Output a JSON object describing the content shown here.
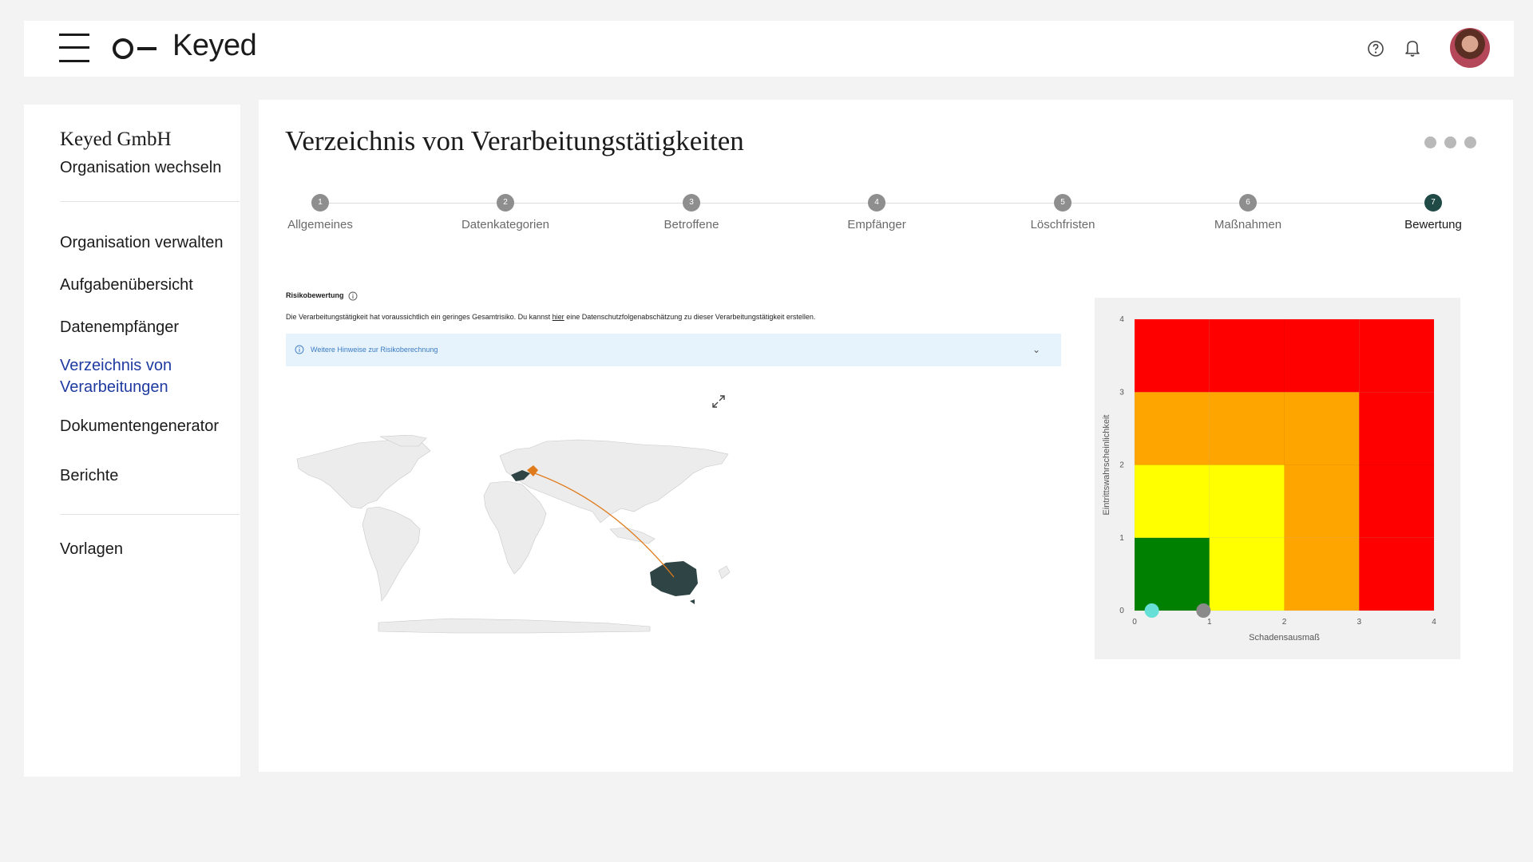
{
  "app": {
    "logo_text": "Keyed"
  },
  "sidebar": {
    "org_name": "Keyed GmbH",
    "switch_label": "Organisation wechseln",
    "items": [
      {
        "label": "Organisation verwalten"
      },
      {
        "label": "Aufgabenübersicht"
      },
      {
        "label": "Datenempfänger"
      },
      {
        "label": "Verzeichnis von Verarbeitungen",
        "active": true
      },
      {
        "label": "Dokumentengenerator"
      },
      {
        "label": "Berichte"
      },
      {
        "label": "Vorlagen"
      }
    ]
  },
  "main": {
    "title": "Verzeichnis von Verarbeitungstätigkeiten",
    "steps": [
      {
        "num": "1",
        "label": "Allgemeines"
      },
      {
        "num": "2",
        "label": "Datenkategorien"
      },
      {
        "num": "3",
        "label": "Betroffene"
      },
      {
        "num": "4",
        "label": "Empfänger"
      },
      {
        "num": "5",
        "label": "Löschfristen"
      },
      {
        "num": "6",
        "label": "Maßnahmen"
      },
      {
        "num": "7",
        "label": "Bewertung",
        "current": true
      }
    ],
    "risk": {
      "heading": "Risikobewertung",
      "text_before": "Die Verarbeitungstätigkeit hat voraussichtlich ein geringes Gesamtrisiko. Du kannst ",
      "link": "hier",
      "text_after": " eine Datenschutzfolgenabschätzung zu dieser Verarbeitungstätigkeit erstellen.",
      "hint": "Weitere Hinweise zur Risikoberechnung"
    }
  },
  "icons": {
    "menu": "hamburger-icon",
    "help": "help-icon",
    "notifications": "bell-icon",
    "expand": "expand-icon",
    "info": "info-icon",
    "chevron": "chevron-down-icon"
  },
  "colors": {
    "accent_link": "#1f3aa0",
    "step_current": "#1f4a46",
    "map_highlight": "#2f4444",
    "map_route": "#e07b1c",
    "risk_low": "#008000",
    "risk_medium": "#ffff00",
    "risk_high": "#ffa500",
    "risk_very_high": "#ff0000"
  },
  "chart_data": {
    "type": "heatmap",
    "xlabel": "Schadensausmaß",
    "ylabel": "Eintrittswahrscheinlichkeit",
    "xlim": [
      0,
      4
    ],
    "ylim": [
      0,
      4
    ],
    "x_ticks": [
      "0",
      "1",
      "2",
      "3",
      "4"
    ],
    "y_ticks": [
      "0",
      "1",
      "2",
      "3",
      "4"
    ],
    "grid": [
      [
        "#008000",
        "#ffff00",
        "#ffa500",
        "#ff0000"
      ],
      [
        "#ffff00",
        "#ffff00",
        "#ffa500",
        "#ff0000"
      ],
      [
        "#ffa500",
        "#ffa500",
        "#ffa500",
        "#ff0000"
      ],
      [
        "#ff0000",
        "#ff0000",
        "#ff0000",
        "#ff0000"
      ]
    ],
    "points": [
      {
        "x": 0.23,
        "y": 0,
        "color": "#66e0d6"
      },
      {
        "x": 0.92,
        "y": 0,
        "color": "#8a8a8a"
      }
    ]
  }
}
